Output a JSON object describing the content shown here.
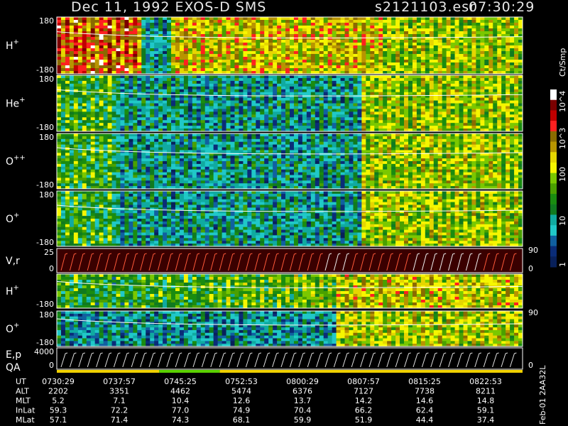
{
  "header": {
    "title": "Dec 11, 1992   EXOS-D SMS",
    "file": "s2121103.esr",
    "time": "07:30:29"
  },
  "chart_data": {
    "type": "heatmap",
    "title": "Dec 11, 1992   EXOS-D SMS",
    "colorbar": {
      "label": "Ct/Smp",
      "scale": "log",
      "ticks": [
        "10^4",
        "10^3",
        "100",
        "10",
        "1"
      ],
      "colors": [
        "#ffffff",
        "#7a0000",
        "#c00000",
        "#ff2020",
        "#8a6a00",
        "#b89400",
        "#e6d600",
        "#f6f600",
        "#7ac800",
        "#4aa000",
        "#1a8c10",
        "#107a20",
        "#10aaa0",
        "#20c8c8",
        "#1060a0",
        "#0a2c78",
        "#08205a"
      ]
    },
    "panels": [
      {
        "name": "H+",
        "label_main": "H",
        "label_sup": "+",
        "y_top": "180",
        "y_bottom": "-180"
      },
      {
        "name": "He+",
        "label_main": "He",
        "label_sup": "+",
        "y_top": "180",
        "y_bottom": "-180"
      },
      {
        "name": "O++",
        "label_main": "O",
        "label_sup": "++",
        "y_top": "180",
        "y_bottom": "-180"
      },
      {
        "name": "O+",
        "label_main": "O",
        "label_sup": "+",
        "y_top": "180",
        "y_bottom": "-180"
      },
      {
        "name": "V,r",
        "label_main": "V,r",
        "label_sup": "",
        "y_top": "25",
        "y_bottom": "0",
        "right_top": "90",
        "right_bottom": "0"
      },
      {
        "name": "H+ (lower)",
        "label_main": "H",
        "label_sup": "+",
        "y_top": "",
        "y_bottom": "-180"
      },
      {
        "name": "O+ (lower)",
        "label_main": "O",
        "label_sup": "+",
        "y_top": "180",
        "y_bottom": "-180",
        "right_top": "90"
      },
      {
        "name": "E,p QA",
        "label_main": "E,p",
        "label2": "QA",
        "label_sup": "",
        "y_top": "4000",
        "y_bottom": "0",
        "right_top": "",
        "right_bottom": "0"
      }
    ],
    "table": {
      "rows": [
        {
          "label": "UT",
          "values": [
            "0730:29",
            "0737:57",
            "0745:25",
            "0752:53",
            "0800:29",
            "0807:57",
            "0815:25",
            "0822:53"
          ]
        },
        {
          "label": "ALT",
          "values": [
            "2202",
            "3351",
            "4462",
            "5474",
            "6376",
            "7127",
            "7738",
            "8211"
          ]
        },
        {
          "label": "MLT",
          "values": [
            "5.2",
            "7.1",
            "10.4",
            "12.6",
            "13.7",
            "14.2",
            "14.6",
            "14.8"
          ]
        },
        {
          "label": "InLat",
          "values": [
            "59.3",
            "72.2",
            "77.0",
            "74.9",
            "70.4",
            "66.2",
            "62.4",
            "59.1"
          ]
        },
        {
          "label": "MLat",
          "values": [
            "57.1",
            "71.4",
            "74.3",
            "68.1",
            "59.9",
            "51.9",
            "44.4",
            "37.4"
          ]
        }
      ]
    },
    "side_label": "Feb-01 2AA32L"
  }
}
